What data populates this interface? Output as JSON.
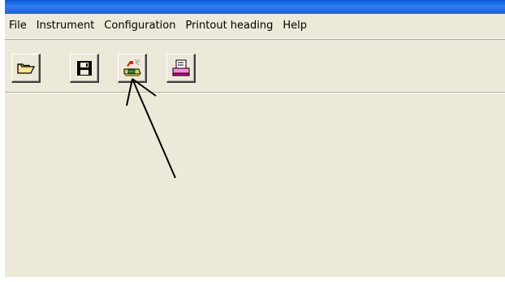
{
  "menu": {
    "items": [
      "File",
      "Instrument",
      "Configuration",
      "Printout heading",
      "Help"
    ]
  },
  "toolbar": {
    "buttons": [
      {
        "name": "open",
        "icon": "folder-open-icon"
      },
      {
        "name": "save",
        "icon": "floppy-disk-icon"
      },
      {
        "name": "instrument-connect",
        "icon": "instrument-transfer-icon"
      },
      {
        "name": "print",
        "icon": "printer-icon"
      }
    ]
  },
  "colors": {
    "titlebar": "#0a5bd8",
    "window_bg": "#ece9d8",
    "annotation_arrow": "#000000"
  }
}
